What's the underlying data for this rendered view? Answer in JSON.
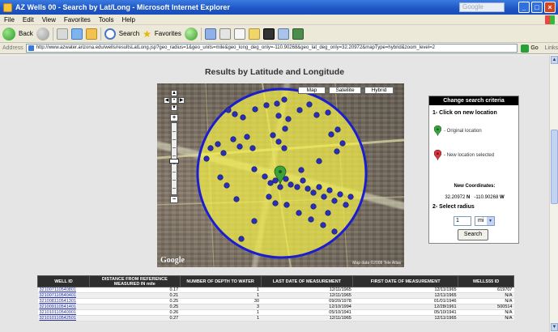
{
  "window": {
    "title": "AZ Wells 00 - Search by Lat/Long - Microsoft Internet Explorer",
    "search_box": "Google"
  },
  "menu": [
    "File",
    "Edit",
    "View",
    "Favorites",
    "Tools",
    "Help"
  ],
  "toolbar": {
    "back": "Back",
    "search": "Search",
    "favorites": "Favorites"
  },
  "address": {
    "label": "Address",
    "url": "http://www.azwater.arizona.edu/wells/resultsLatLong.jsp?geo_radius=1&geo_units=mile&geo_long_deg_only=-110.90268&geo_lat_deg_only=32.20972&mapType=hybrid&zoom_level=2",
    "go": "Go",
    "links": "Links"
  },
  "page": {
    "title": "Results by Latitude and Longitude"
  },
  "map": {
    "buttons": {
      "map": "Map",
      "satellite": "Satellite",
      "hybrid": "Hybrid"
    },
    "logo": "Google",
    "credit": "Map data ©2008 Tele Atlas"
  },
  "search_panel": {
    "header": "Change search criteria",
    "step1": "1- Click on new location",
    "original": "- Original location",
    "new_loc": "- New location selected",
    "coords_label": "New Coordinates:",
    "lat": "32.20972",
    "lat_dir": "N",
    "lon": "-110.90268",
    "lon_dir": "W",
    "step2": "2- Select radius",
    "radius": "1",
    "unit": "mi",
    "search_button": "Search",
    "pin_original_color": "#3ca33c",
    "pin_new_color": "#d0393f"
  },
  "table": {
    "headers": [
      "WELL ID",
      "DISTANCE FROM REFERENCE MEASURED IN mile",
      "NUMBER OF DEPTH TO WATER",
      "LAST DATE OF MEASUREMENT",
      "FIRST DATE OF MEASUREMENT",
      "WELLS55 ID"
    ],
    "rows": [
      [
        "321007110540801",
        "0.17",
        "1",
        "12/11/1965",
        "12/11/1965",
        "619707"
      ],
      [
        "321007110540401",
        "0.21",
        "1",
        "12/11/1965",
        "12/11/1965",
        "N/A"
      ],
      [
        "321008110541301",
        "0.25",
        "30",
        "09/20/1978",
        "01/01/1946",
        "N/A"
      ],
      [
        "321009110541401",
        "0.25",
        "3",
        "12/10/1994",
        "12/28/1961",
        "500514"
      ],
      [
        "321010110540901",
        "0.26",
        "1",
        "05/10/1941",
        "05/10/1941",
        "N/A"
      ],
      [
        "321010110542501",
        "0.27",
        "1",
        "12/11/1965",
        "12/11/1965",
        "N/A"
      ]
    ]
  }
}
